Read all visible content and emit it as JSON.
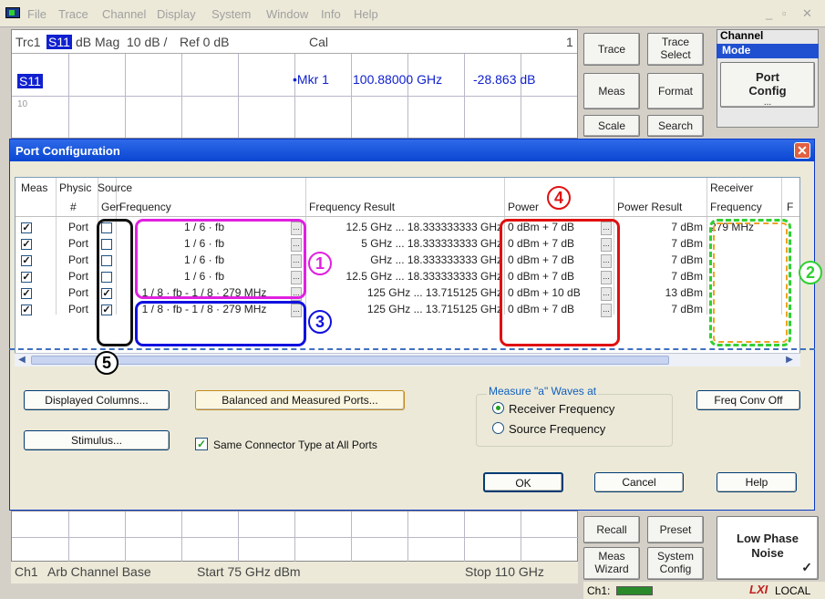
{
  "menu": {
    "items": [
      "File",
      "Trace",
      "Channel",
      "Display",
      "System",
      "Window",
      "Info",
      "Help"
    ],
    "window_controls": [
      "_",
      "▫",
      "✕"
    ]
  },
  "trace": {
    "trace_id": "Trc1",
    "param": "S11",
    "format": "dB Mag",
    "scale": "10 dB /",
    "ref": "Ref 0 dB",
    "cal": "Cal",
    "trace_num": "1",
    "label": "S11",
    "marker": "•Mkr 1",
    "marker_freq": "100.88000 GHz",
    "marker_value": "-28.863 dB",
    "y_tick": "10"
  },
  "softkeys": {
    "trace": "Trace",
    "trace_select": "Trace Select",
    "meas": "Meas",
    "format": "Format",
    "scale": "Scale",
    "search": "Search",
    "channel": "Channel",
    "mode": "Mode",
    "port_config": "Port Config",
    "port_config_sub": "...",
    "recall": "Recall",
    "preset": "Preset",
    "meas_wizard": "Meas Wizard",
    "system_config": "System Config",
    "low_phase_noise": "Low Phase Noise",
    "lpn_check": "✓"
  },
  "dialog": {
    "title": "Port Configuration",
    "close": "✕",
    "headers": {
      "meas": "Meas",
      "physical": "Physic",
      "num": "#",
      "source": "Source",
      "gen": "Gen",
      "frequency": "Frequency",
      "frequency_result": "Frequency Result",
      "power": "Power",
      "power_result": "Power Result",
      "receiver": "Receiver",
      "receiver_frequency": "Frequency",
      "extra": "F"
    },
    "rows": [
      {
        "meas": true,
        "port": "Port",
        "gen": false,
        "freq": "1 / 6 · fb",
        "freq_result": "12.5 GHz ... 18.333333333 GHz",
        "power": "0 dBm + 7 dB",
        "power_result": "7 dBm",
        "rx_freq": "279 MHz"
      },
      {
        "meas": true,
        "port": "Port",
        "gen": false,
        "freq": "1 / 6 · fb",
        "freq_result": "5 GHz ... 18.333333333 GHz",
        "power": "0 dBm + 7 dB",
        "power_result": "7 dBm",
        "rx_freq": ""
      },
      {
        "meas": true,
        "port": "Port",
        "gen": false,
        "freq": "1 / 6 · fb",
        "freq_result": "GHz ... 18.333333333 GHz",
        "power": "0 dBm + 7 dB",
        "power_result": "7 dBm",
        "rx_freq": ""
      },
      {
        "meas": true,
        "port": "Port",
        "gen": false,
        "freq": "1 / 6 · fb",
        "freq_result": "12.5 GHz ... 18.333333333 GHz",
        "power": "0 dBm + 7 dB",
        "power_result": "7 dBm",
        "rx_freq": ""
      },
      {
        "meas": true,
        "port": "Port",
        "gen": true,
        "freq": "1 / 8 · fb - 1 / 8 · 279 MHz",
        "freq_result": "125 GHz ... 13.715125 GHz",
        "power": "0 dBm + 10 dB",
        "power_result": "13 dBm",
        "rx_freq": ""
      },
      {
        "meas": true,
        "port": "Port",
        "gen": true,
        "freq": "1 / 8 · fb - 1 / 8 · 279 MHz",
        "freq_result": "125 GHz ... 13.715125 GHz",
        "power": "0 dBm + 7 dB",
        "power_result": "7 dBm",
        "rx_freq": ""
      }
    ],
    "buttons": {
      "displayed_columns": "Displayed Columns...",
      "balanced": "Balanced and Measured Ports...",
      "freq_conv_off": "Freq Conv Off",
      "stimulus": "Stimulus...",
      "ok": "OK",
      "cancel": "Cancel",
      "help": "Help"
    },
    "same_connector": "Same Connector Type at All Ports",
    "measure_group": "Measure \"a\" Waves at",
    "radio_receiver": "Receiver Frequency",
    "radio_source": "Source Frequency"
  },
  "annotations": [
    "1",
    "2",
    "3",
    "4",
    "5"
  ],
  "annotation_colors": {
    "1": "#e020e0",
    "2": "#30d030",
    "3": "#1010e0",
    "4": "#e01010",
    "5": "#000000"
  },
  "status": {
    "channel": "Ch1",
    "channel_name": "Arb Channel Base",
    "start": "Start 75 GHz dBm",
    "stop": "Stop 110 GHz",
    "ch_indicator": "Ch1:",
    "lxi": "LXI",
    "local": "LOCAL"
  }
}
